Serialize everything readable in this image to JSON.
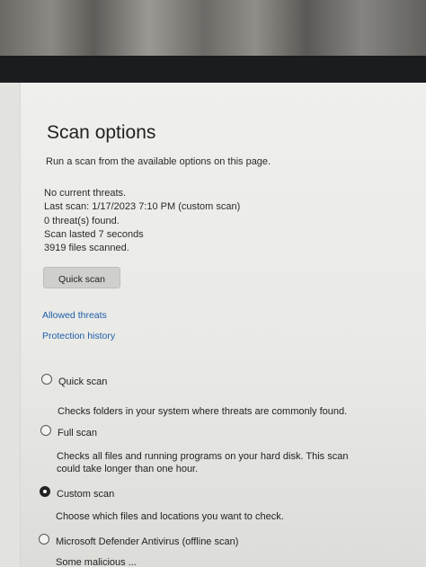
{
  "page": {
    "title": "Scan options",
    "subtitle": "Run a scan from the available options on this page."
  },
  "status": {
    "threats": "No current threats.",
    "last_scan": "Last scan: 1/17/2023 7:10 PM (custom scan)",
    "found": "0 threat(s) found.",
    "duration": "Scan lasted 7 seconds",
    "files": "3919 files scanned."
  },
  "actions": {
    "quick_scan_button": "Quick scan"
  },
  "links": {
    "allowed_threats": "Allowed threats",
    "protection_history": "Protection history"
  },
  "options": [
    {
      "label": "Quick scan",
      "description": "Checks folders in your system where threats are commonly found.",
      "selected": false
    },
    {
      "label": "Full scan",
      "description": "Checks all files and running programs on your hard disk. This scan could take longer than one hour.",
      "selected": false
    },
    {
      "label": "Custom scan",
      "description": "Choose which files and locations you want to check.",
      "selected": true
    },
    {
      "label": "Microsoft Defender Antivirus (offline scan)",
      "description": "Some malicious ...",
      "selected": false
    }
  ]
}
